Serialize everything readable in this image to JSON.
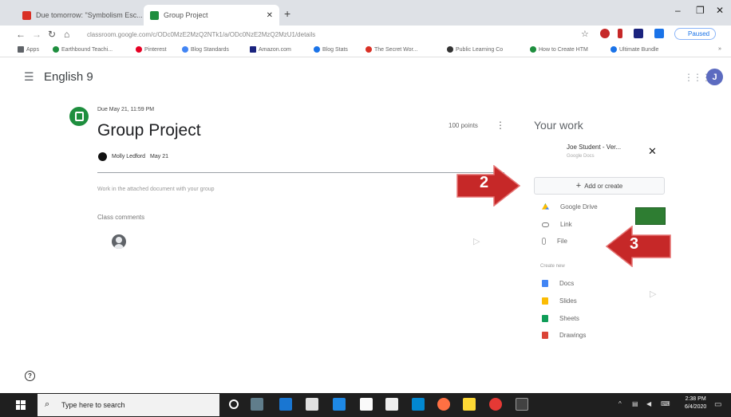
{
  "browser": {
    "tabs": [
      {
        "label": "Due tomorrow: \"Symbolism Esc...",
        "active": false,
        "favicon_color": "#d93025"
      },
      {
        "label": "Group Project",
        "active": true,
        "favicon_color": "#1e8e3e"
      }
    ],
    "new_tab_icon": "plus-icon",
    "window_controls": [
      "minimize-icon",
      "maximize-icon",
      "close-icon"
    ],
    "address": "classroom.google.com/c/ODc0MzE2MzQ2NTk1/a/ODc0NzE2MzQ2MzU1/details",
    "profile_label": "Paused",
    "bookmarks": [
      {
        "label": "Apps",
        "color": "#5f6368"
      },
      {
        "label": "Earthbound Teachi...",
        "color": "#1e8e3e"
      },
      {
        "label": "Pinterest",
        "color": "#e60023"
      },
      {
        "label": "Blog Standards",
        "color": "#4285f4"
      },
      {
        "label": "Amazon.com",
        "color": "#1a237e"
      },
      {
        "label": "Blog Stats",
        "color": "#1a73e8"
      },
      {
        "label": "The Secret Wor...",
        "color": "#d93025"
      },
      {
        "label": "Public Learning Co",
        "color": "#333333"
      },
      {
        "label": "How to Create HTM",
        "color": "#1e8e3e"
      },
      {
        "label": "Ultimate Bundle",
        "color": "#1a73e8"
      }
    ]
  },
  "classroom": {
    "course_title": "English 9",
    "avatar_initial": "J"
  },
  "assignment": {
    "due": "Due May 21, 11:59 PM",
    "title": "Group Project",
    "points": "100 points",
    "author": "Molly Ledford",
    "author_date": "May 21",
    "instructions": "Work in the attached document with your group",
    "comments_label": "Class comments"
  },
  "your_work": {
    "title": "Your work",
    "attached_file_name": "Joe Student - Ver...",
    "attached_file_type": "Google Docs",
    "add_button_label": "Add or create",
    "attach_options": [
      {
        "label": "Google Drive",
        "icon": "google-drive-icon"
      },
      {
        "label": "Link",
        "icon": "link-icon"
      },
      {
        "label": "File",
        "icon": "paperclip-icon"
      }
    ],
    "create_label": "Create new",
    "create_options": [
      {
        "label": "Docs",
        "icon": "docs-icon",
        "color": "#4285f4"
      },
      {
        "label": "Slides",
        "icon": "slides-icon",
        "color": "#fbbc04"
      },
      {
        "label": "Sheets",
        "icon": "sheets-icon",
        "color": "#0f9d58"
      },
      {
        "label": "Drawings",
        "icon": "drawings-icon",
        "color": "#db4437"
      }
    ]
  },
  "callouts": [
    {
      "number": "2",
      "color": "#c62828"
    },
    {
      "number": "3",
      "color": "#c62828"
    }
  ],
  "taskbar": {
    "search_placeholder": "Type here to search",
    "time": "2:38 PM",
    "date": "6/4/2020"
  }
}
